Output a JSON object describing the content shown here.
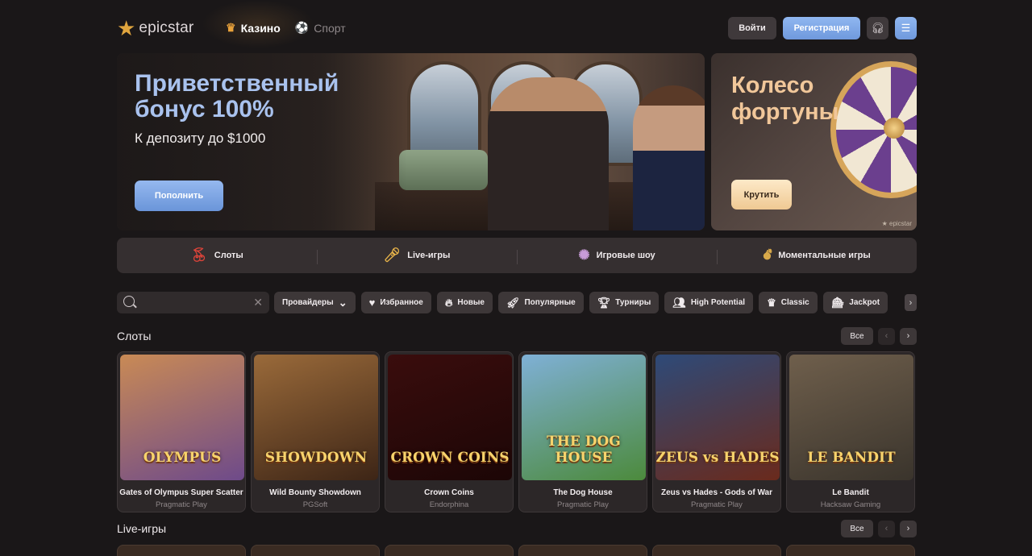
{
  "header": {
    "logo_text": "epicstar",
    "nav": [
      {
        "label": "Казино",
        "icon": "crown-icon",
        "active": true
      },
      {
        "label": "Спорт",
        "icon": "ball-icon",
        "active": false
      }
    ],
    "login_label": "Войти",
    "register_label": "Регистрация",
    "support_icon": "headset-icon",
    "menu_icon": "menu-icon"
  },
  "banners": {
    "main": {
      "title_line1": "Приветственный",
      "title_line2": "бонус 100%",
      "subtitle": "К депозиту до $1000",
      "button_label": "Пополнить"
    },
    "side": {
      "title_line1": "Колесо",
      "title_line2": "фортуны",
      "button_label": "Крутить",
      "watermark": "★ epicstar"
    }
  },
  "categories": [
    {
      "label": "Слоты",
      "icon": "cherry-icon"
    },
    {
      "label": "Live-игры",
      "icon": "microphone-icon"
    },
    {
      "label": "Игровые шоу",
      "icon": "wheel-icon"
    },
    {
      "label": "Моментальные игры",
      "icon": "bomb-icon"
    }
  ],
  "search": {
    "placeholder": ""
  },
  "filters": [
    {
      "label": "Провайдеры",
      "icon": "chevron-down-icon"
    },
    {
      "label": "Избранное",
      "icon": "heart-icon"
    },
    {
      "label": "Новые",
      "icon": "flame-icon"
    },
    {
      "label": "Популярные",
      "icon": "rocket-icon"
    },
    {
      "label": "Турниры",
      "icon": "trophy-icon"
    },
    {
      "label": "High Potential",
      "icon": "people-icon"
    },
    {
      "label": "Classic",
      "icon": "crown-icon"
    },
    {
      "label": "Jackpot",
      "icon": "jackpot-icon"
    }
  ],
  "sections": {
    "slots": {
      "title": "Слоты",
      "all_label": "Все"
    },
    "live": {
      "title": "Live-игры",
      "all_label": "Все"
    }
  },
  "games": [
    {
      "name": "Gates of Olympus Super Scatter",
      "provider": "Pragmatic Play",
      "art": "OLYMPUS",
      "bg": "#c98a55",
      "bg2": "#6e4a8a"
    },
    {
      "name": "Wild Bounty Showdown",
      "provider": "PGSoft",
      "art": "SHOWDOWN",
      "bg": "#9a6a3a",
      "bg2": "#3d2516"
    },
    {
      "name": "Crown Coins",
      "provider": "Endorphina",
      "art": "CROWN COINS",
      "bg": "#3a0d0d",
      "bg2": "#1c0606"
    },
    {
      "name": "The Dog House",
      "provider": "Pragmatic Play",
      "art": "THE DOG HOUSE",
      "bg": "#7fb0d6",
      "bg2": "#4c8a3c"
    },
    {
      "name": "Zeus vs Hades - Gods of War",
      "provider": "Pragmatic Play",
      "art": "ZEUS vs HADES",
      "bg": "#2e4a78",
      "bg2": "#6a2a1c"
    },
    {
      "name": "Le Bandit",
      "provider": "Hacksaw Gaming",
      "art": "LE BANDIT",
      "bg": "#6f5f4c",
      "bg2": "#3a342c"
    }
  ],
  "colors": {
    "accent_blue": "#7fa6e6",
    "accent_gold": "#e0a53e",
    "background": "#1a1718"
  }
}
